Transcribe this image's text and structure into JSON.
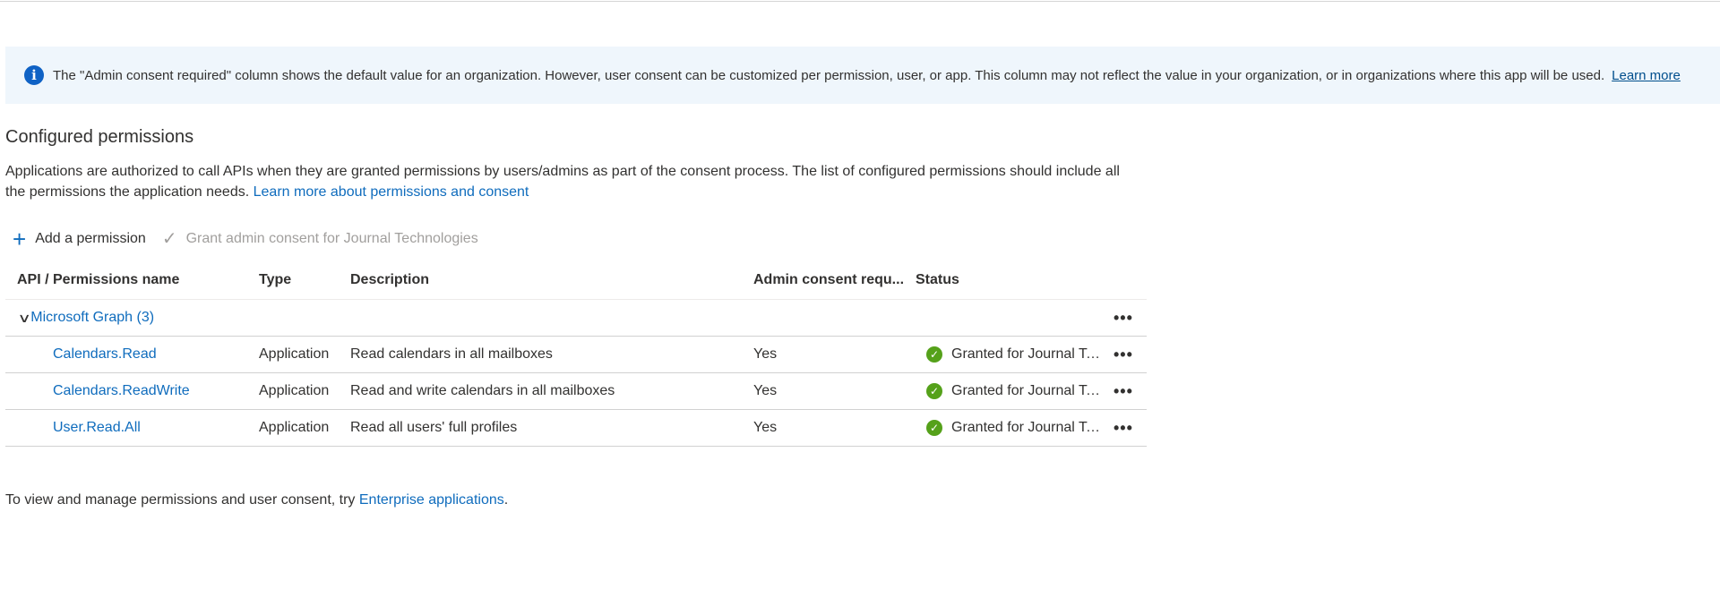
{
  "info_bar": {
    "icon": "info-icon",
    "text": "The \"Admin consent required\" column shows the default value for an organization. However, user consent can be customized per permission, user, or app. This column may not reflect the value in your organization, or in organizations where this app will be used.",
    "link": "Learn more"
  },
  "section": {
    "title": "Configured permissions",
    "description": "Applications are authorized to call APIs when they are granted permissions by users/admins as part of the consent process. The list of configured permissions should include all the permissions the application needs.",
    "link": "Learn more about permissions and consent"
  },
  "toolbar": {
    "add_label": "Add a permission",
    "add_icon": "plus-icon",
    "grant_label": "Grant admin consent for Journal Technologies",
    "grant_icon": "checkmark-icon"
  },
  "table": {
    "headers": [
      "API / Permissions name",
      "Type",
      "Description",
      "Admin consent requ...",
      "Status"
    ],
    "group": {
      "label": "Microsoft Graph (3)",
      "more": "•••"
    },
    "rows": [
      {
        "name": "Calendars.Read",
        "type": "Application",
        "description": "Read calendars in all mailboxes",
        "admin_consent": "Yes",
        "status": "Granted for Journal Technologies",
        "more": "•••"
      },
      {
        "name": "Calendars.ReadWrite",
        "type": "Application",
        "description": "Read and write calendars in all mailboxes",
        "admin_consent": "Yes",
        "status": "Granted for Journal Technologies",
        "more": "•••"
      },
      {
        "name": "User.Read.All",
        "type": "Application",
        "description": "Read all users' full profiles",
        "admin_consent": "Yes",
        "status": "Granted for Journal Technologies",
        "more": "•••"
      }
    ]
  },
  "footer": {
    "text": "To view and manage permissions and user consent, try ",
    "link": "Enterprise applications",
    "suffix": "."
  },
  "colors": {
    "accent": "#0f6cbd",
    "info_bg": "#eff6fc",
    "success": "#55a11a",
    "disabled": "#a19f9d"
  }
}
